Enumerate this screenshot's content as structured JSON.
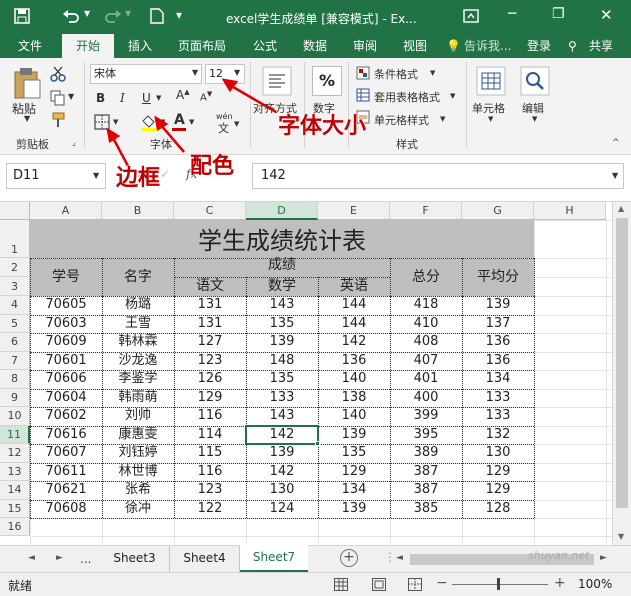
{
  "window": {
    "title": "excel学生成绩单  [兼容模式] - Ex..."
  },
  "tabs": [
    "文件",
    "开始",
    "插入",
    "页面布局",
    "公式",
    "数据",
    "审阅",
    "视图"
  ],
  "tell_me": "告诉我...",
  "login": "登录",
  "share": "共享",
  "ribbon": {
    "paste": "粘贴",
    "clipboard": "剪贴板",
    "font_name": "宋体",
    "font_size": "12",
    "bold": "B",
    "italic": "I",
    "underline": "U",
    "font_group": "字体",
    "align": "对齐方式",
    "number": "数字",
    "percent": "%",
    "cond_format": "条件格式",
    "table_format": "套用表格格式",
    "cell_style": "单元格样式",
    "styles": "样式",
    "cells": "单元格",
    "edit": "编辑",
    "wen": "wén"
  },
  "annotations": {
    "font_size": "字体大小",
    "border": "边框",
    "fill": "配色"
  },
  "formula": {
    "name_box": "D11",
    "value": "142"
  },
  "columns": [
    "A",
    "B",
    "C",
    "D",
    "E",
    "F",
    "G",
    "H"
  ],
  "rows": [
    "1",
    "2",
    "3",
    "4",
    "5",
    "6",
    "7",
    "8",
    "9",
    "10",
    "11",
    "12",
    "13",
    "14",
    "15",
    "16"
  ],
  "sheet": {
    "title": "学生成绩统计表",
    "h_id": "学号",
    "h_name": "名字",
    "h_scores": "成绩",
    "h_chinese": "语文",
    "h_math": "数学",
    "h_english": "英语",
    "h_total": "总分",
    "h_avg": "平均分",
    "data": [
      [
        "70605",
        "杨璐",
        "131",
        "143",
        "144",
        "418",
        "139"
      ],
      [
        "70603",
        "王雪",
        "131",
        "135",
        "144",
        "410",
        "137"
      ],
      [
        "70609",
        "韩林霖",
        "127",
        "139",
        "142",
        "408",
        "136"
      ],
      [
        "70601",
        "沙龙逸",
        "123",
        "148",
        "136",
        "407",
        "136"
      ],
      [
        "70606",
        "李鉴学",
        "126",
        "135",
        "140",
        "401",
        "134"
      ],
      [
        "70604",
        "韩雨萌",
        "129",
        "133",
        "138",
        "400",
        "133"
      ],
      [
        "70602",
        "刘帅",
        "116",
        "143",
        "140",
        "399",
        "133"
      ],
      [
        "70616",
        "康惠雯",
        "114",
        "142",
        "139",
        "395",
        "132"
      ],
      [
        "70607",
        "刘钰婷",
        "115",
        "139",
        "135",
        "389",
        "130"
      ],
      [
        "70611",
        "林世博",
        "116",
        "142",
        "129",
        "387",
        "129"
      ],
      [
        "70621",
        "张希",
        "123",
        "130",
        "134",
        "387",
        "129"
      ],
      [
        "70608",
        "徐冲",
        "122",
        "124",
        "139",
        "385",
        "128"
      ]
    ]
  },
  "sheets": {
    "s3": "Sheet3",
    "s4": "Sheet4",
    "s7": "Sheet7",
    "more": "..."
  },
  "status": {
    "ready": "就绪",
    "zoom": "100%"
  },
  "watermark": "shuyan.net"
}
